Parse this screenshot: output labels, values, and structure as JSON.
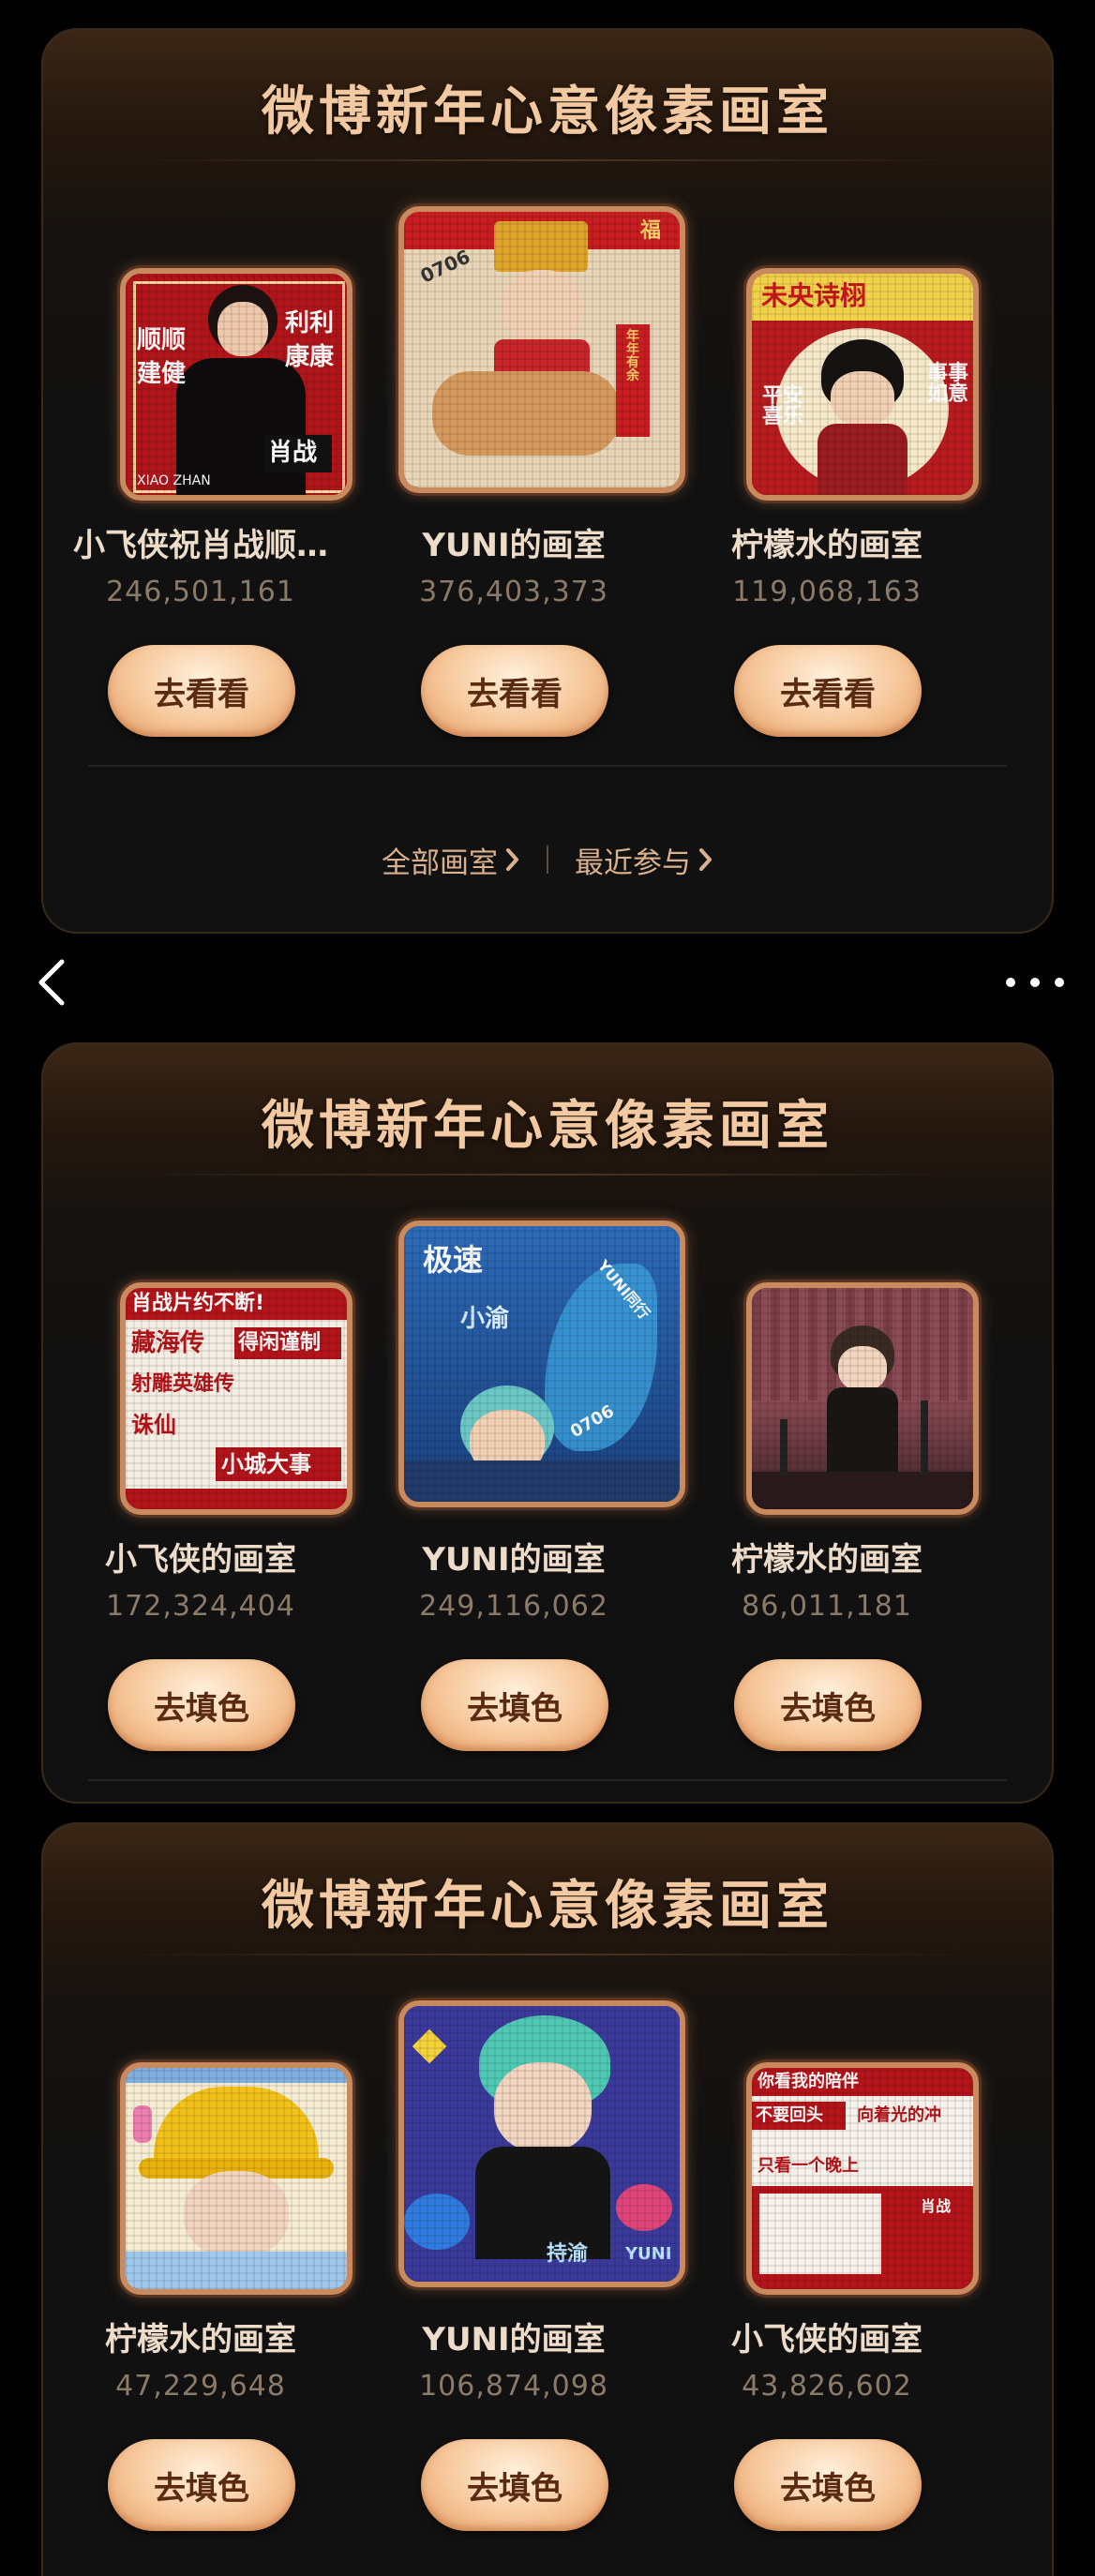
{
  "cards": [
    {
      "title": "微博新年心意像素画室",
      "tiles": [
        {
          "name": "小飞侠祝肖战顺…",
          "count": "246,501,161",
          "button": "去看看",
          "art": {
            "t1": "顺顺",
            "t2": "建健",
            "t3": "利利",
            "t4": "康康",
            "t5": "肖战",
            "t6": "XIAO ZHAN"
          }
        },
        {
          "name": "YUNI的画室",
          "count": "376,403,373",
          "button": "去看看",
          "art": {
            "t1": "0706",
            "t2": "福",
            "t3": "年年有余"
          }
        },
        {
          "name": "柠檬水的画室",
          "count": "119,068,163",
          "button": "去看看",
          "art": {
            "t1": "未央诗栩",
            "t2": "平安喜乐",
            "t3": "事事如意"
          }
        }
      ],
      "footer": {
        "all_label": "全部画室",
        "recent_label": "最近参与"
      }
    },
    {
      "title": "微博新年心意像素画室",
      "tiles": [
        {
          "name": "小飞侠的画室",
          "count": "172,324,404",
          "button": "去填色",
          "art": {
            "t1": "肖战片约不断!",
            "t2": "藏海传",
            "t3": "得闲谨制",
            "t4": "射雕英雄传",
            "t5": "诛仙",
            "t6": "小城大事"
          }
        },
        {
          "name": "YUNI的画室",
          "count": "249,116,062",
          "button": "去填色",
          "art": {
            "t1": "极速",
            "t2": "小渝",
            "t3": "YUNI同行",
            "t4": "0706"
          }
        },
        {
          "name": "柠檬水的画室",
          "count": "86,011,181",
          "button": "去填色",
          "art": {}
        }
      ]
    },
    {
      "title": "微博新年心意像素画室",
      "tiles": [
        {
          "name": "柠檬水的画室",
          "count": "47,229,648",
          "button": "去填色",
          "art": {}
        },
        {
          "name": "YUNI的画室",
          "count": "106,874,098",
          "button": "去填色",
          "art": {
            "t1": "持渝",
            "t2": "YUNI"
          }
        },
        {
          "name": "小飞侠的画室",
          "count": "43,826,602",
          "button": "去填色",
          "art": {
            "t1": "你看我的陪伴",
            "t2": "不要回头",
            "t3": "向着光的冲",
            "t4": "只看一个晚上",
            "t5": "肖战"
          }
        }
      ]
    }
  ],
  "nav": {
    "back_icon": "chevron-left-icon",
    "more_icon": "more-dots-icon"
  },
  "colors": {
    "title": "#f2c9a0",
    "button_bg": "#f6c79a",
    "button_text": "#5a2b10",
    "count": "#8c7a68",
    "frame": "#c98a5e"
  }
}
